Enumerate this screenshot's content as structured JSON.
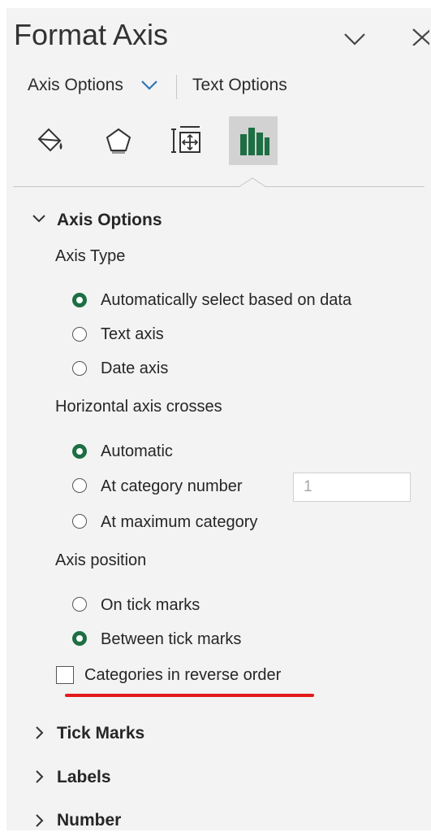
{
  "header": {
    "title": "Format Axis",
    "tabs": [
      {
        "label": "Axis Options",
        "active": true
      },
      {
        "label": "Text Options",
        "active": false
      }
    ]
  },
  "icon_tabs": [
    {
      "name": "fill-line-icon",
      "active": false
    },
    {
      "name": "effects-icon",
      "active": false
    },
    {
      "name": "size-properties-icon",
      "active": false
    },
    {
      "name": "axis-options-icon",
      "active": true
    }
  ],
  "axis_options": {
    "title": "Axis Options",
    "axis_type": {
      "label": "Axis Type",
      "options": [
        {
          "label": "Automatically select based on data",
          "checked": true
        },
        {
          "label": "Text axis",
          "checked": false
        },
        {
          "label": "Date axis",
          "checked": false
        }
      ]
    },
    "horizontal_axis_crosses": {
      "label": "Horizontal axis crosses",
      "options": [
        {
          "label": "Automatic",
          "checked": true
        },
        {
          "label": "At category number",
          "checked": false
        },
        {
          "label": "At maximum category",
          "checked": false
        }
      ],
      "category_number_value": "1"
    },
    "axis_position": {
      "label": "Axis position",
      "options": [
        {
          "label": "On tick marks",
          "checked": false
        },
        {
          "label": "Between tick marks",
          "checked": true
        }
      ]
    },
    "reverse_order": {
      "label": "Categories in reverse order",
      "checked": false
    }
  },
  "collapsed_sections": [
    "Tick Marks",
    "Labels",
    "Number"
  ],
  "colors": {
    "accent_green": "#1e6e43",
    "annotation_red": "#e31b1b",
    "chevron_blue": "#2e75b6"
  }
}
